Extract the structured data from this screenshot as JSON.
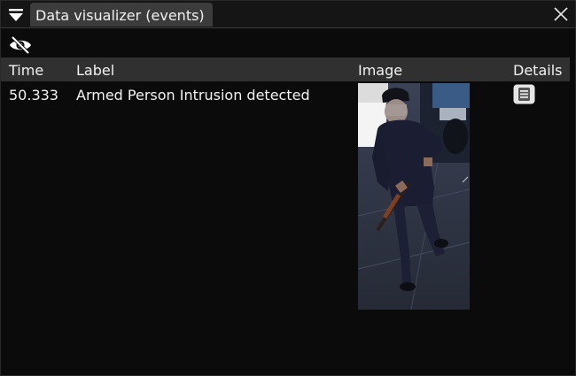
{
  "window": {
    "tab_title": "Data visualizer (events)"
  },
  "icons": {
    "collapse": "triangle-down-icon",
    "close": "close-icon",
    "visibility": "eye-slash-icon",
    "details": "document-icon"
  },
  "table": {
    "columns": [
      "Time",
      "Label",
      "Image",
      "Details"
    ],
    "rows": [
      {
        "time": "50.333",
        "label": "Armed Person Intrusion detected"
      }
    ]
  },
  "colors": {
    "background": "#0b0b0b",
    "tab": "#3c3c3c",
    "header_row": "#303030",
    "text": "#f2f2f2"
  }
}
